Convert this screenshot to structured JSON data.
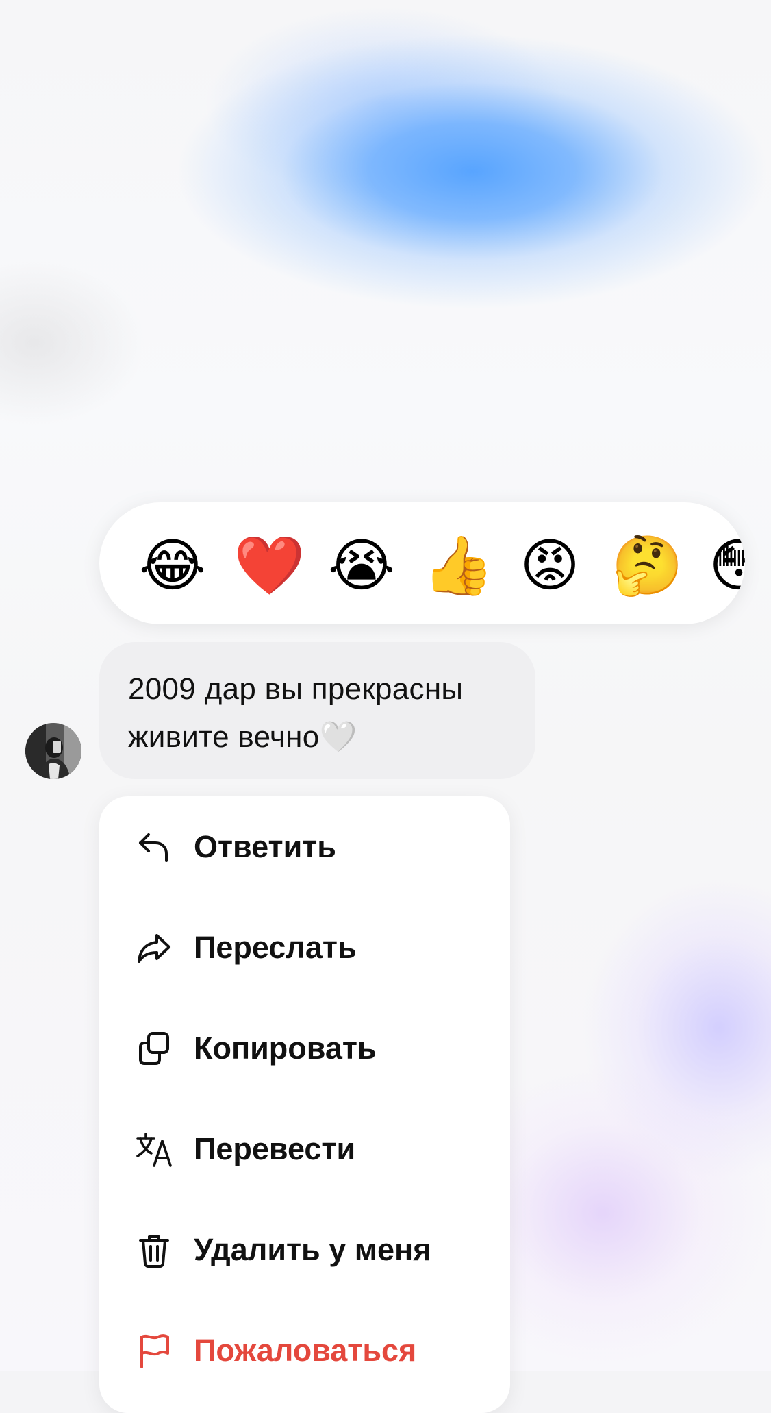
{
  "reactions": [
    {
      "name": "laughing-tears-emoji",
      "glyph": "😂"
    },
    {
      "name": "red-heart-emoji",
      "glyph": "❤️"
    },
    {
      "name": "crying-emoji",
      "glyph": "😭"
    },
    {
      "name": "thumbs-up-emoji",
      "glyph": "👍"
    },
    {
      "name": "angry-face-emoji",
      "glyph": "😡"
    },
    {
      "name": "thinking-face-emoji",
      "glyph": "🤔"
    },
    {
      "name": "flushed-face-emoji",
      "glyph": "😳"
    }
  ],
  "message": {
    "text": "2009 дар вы прекрасны\nживите вечно🤍"
  },
  "menu": {
    "items": [
      {
        "id": "reply",
        "label": "Ответить",
        "icon": "reply-arrow-icon"
      },
      {
        "id": "forward",
        "label": "Переслать",
        "icon": "forward-arrow-icon"
      },
      {
        "id": "copy",
        "label": "Копировать",
        "icon": "copy-icon"
      },
      {
        "id": "translate",
        "label": "Перевести",
        "icon": "translate-icon"
      },
      {
        "id": "delete",
        "label": "Удалить у меня",
        "icon": "trash-icon"
      },
      {
        "id": "report",
        "label": "Пожаловаться",
        "icon": "flag-icon",
        "color": "#e4483d"
      }
    ]
  },
  "colors": {
    "accent_danger": "#e4483d",
    "bubble": "#efeff1",
    "text": "#111111"
  }
}
